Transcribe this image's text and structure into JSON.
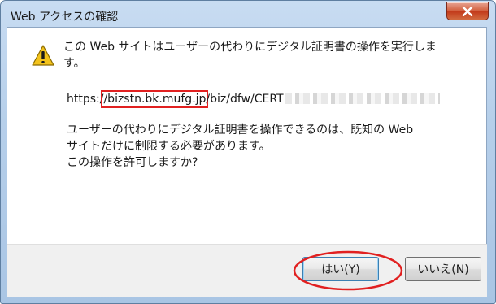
{
  "window": {
    "title": "Web アクセスの確認"
  },
  "dialog": {
    "message": "この Web サイトはユーザーの代わりにデジタル証明書の操作を実行します。",
    "url": {
      "prefix": "https:/",
      "host": "/bizstn.bk.mufg.jp",
      "path": "/biz/dfw/CERT"
    },
    "note_lines": [
      "ユーザーの代わりにデジタル証明書を操作できるのは、既知の Web",
      "サイトだけに制限する必要があります。",
      "この操作を許可しますか?"
    ]
  },
  "buttons": {
    "yes_label": "はい(Y)",
    "no_label": "いいえ(N)"
  },
  "colors": {
    "annotation": "#e12020",
    "title_bar": "#b6cfea"
  },
  "icons": {
    "warning": "warning-icon",
    "close": "close-icon"
  }
}
